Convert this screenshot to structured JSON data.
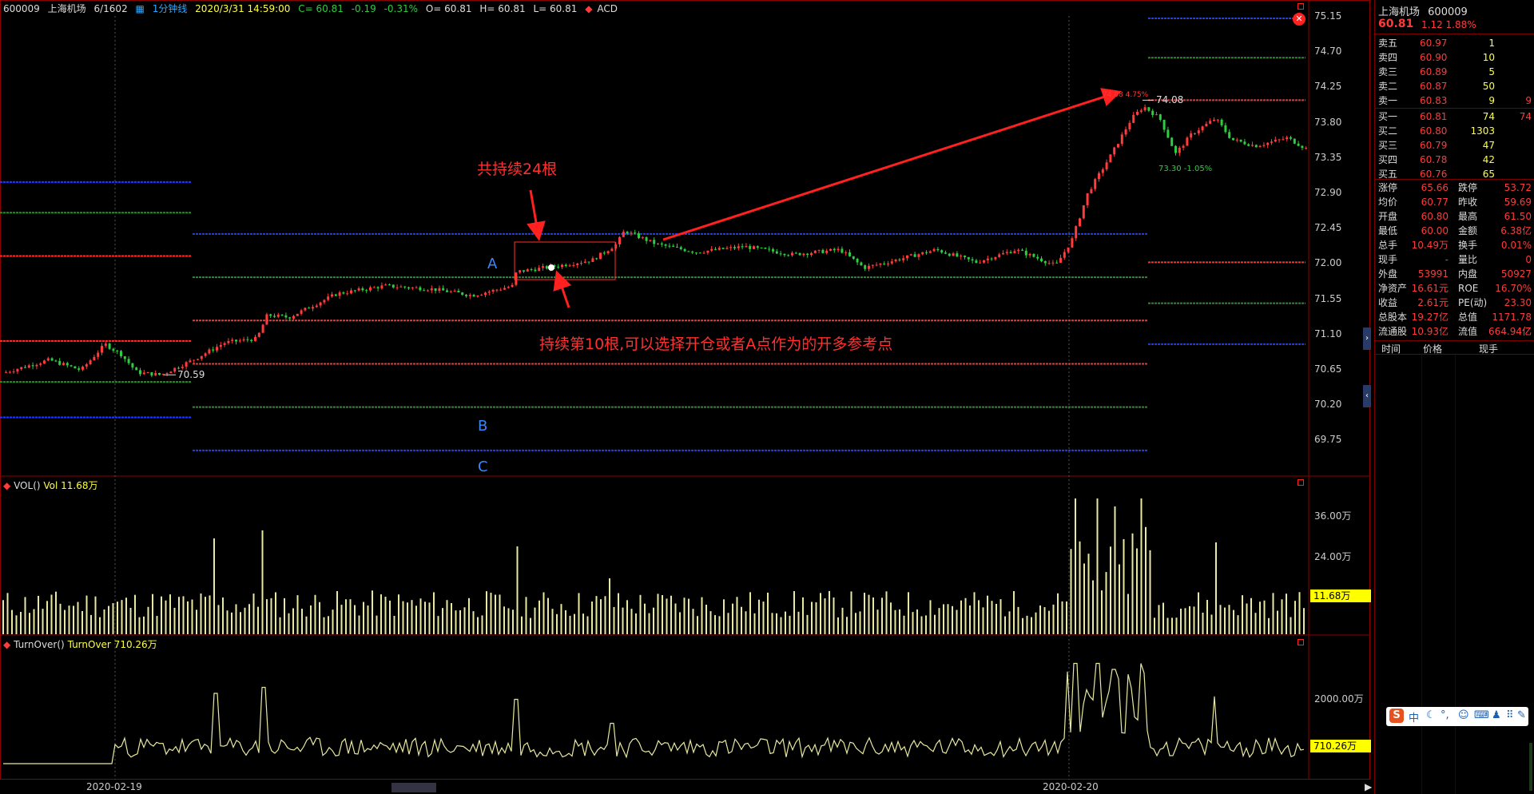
{
  "topbar": {
    "code": "600009",
    "name": "上海机场",
    "position": "6/1602",
    "period": "1分钟线",
    "datetime": "2020/3/31 14:59:00",
    "close": "C= 60.81",
    "change": "-0.19",
    "change_pct": "-0.31%",
    "open": "O= 60.81",
    "high": "H= 60.81",
    "low": "L= 60.81",
    "indicator": "ACD"
  },
  "price_axis": [
    "75.15",
    "74.70",
    "74.25",
    "73.80",
    "73.35",
    "72.90",
    "72.45",
    "72.00",
    "71.55",
    "71.10",
    "70.65",
    "70.20",
    "69.75"
  ],
  "vol_axis": [
    "36.00万",
    "24.00万"
  ],
  "vol_header": {
    "name": "VOL()",
    "value": "Vol 11.68万"
  },
  "vol_badge": "11.68万",
  "turnover_axis": [
    "2000.00万"
  ],
  "turnover_header": {
    "name": "TurnOver()",
    "value": "TurnOver 710.26万"
  },
  "turnover_badge": "710.26万",
  "dates": [
    "2020-02-19",
    "2020-02-20"
  ],
  "chart_labels": {
    "low_mark": "70.59",
    "high_mark": "74.08",
    "high_mark_small": "74.08 4.75%",
    "low2_mark": "73.30 -1.05%"
  },
  "annotations": {
    "top": "共持续24根",
    "bottom": "持续第10根,可以选择开仓或者A点作为的开多参考点",
    "label_a": "A",
    "label_b": "B",
    "label_c": "C"
  },
  "quote": {
    "name": "上海机场",
    "code": "600009",
    "price": "60.81",
    "change": "1.12 1.88%",
    "asks": [
      {
        "label": "卖五",
        "price": "60.97",
        "vol": "1",
        "extra": ""
      },
      {
        "label": "卖四",
        "price": "60.90",
        "vol": "10",
        "extra": ""
      },
      {
        "label": "卖三",
        "price": "60.89",
        "vol": "5",
        "extra": ""
      },
      {
        "label": "卖二",
        "price": "60.87",
        "vol": "50",
        "extra": ""
      },
      {
        "label": "卖一",
        "price": "60.83",
        "vol": "9",
        "extra": "9"
      }
    ],
    "bids": [
      {
        "label": "买一",
        "price": "60.81",
        "vol": "74",
        "extra": "74"
      },
      {
        "label": "买二",
        "price": "60.80",
        "vol": "1303",
        "extra": ""
      },
      {
        "label": "买三",
        "price": "60.79",
        "vol": "47",
        "extra": ""
      },
      {
        "label": "买四",
        "price": "60.78",
        "vol": "42",
        "extra": ""
      },
      {
        "label": "买五",
        "price": "60.76",
        "vol": "65",
        "extra": ""
      }
    ],
    "stats": [
      {
        "l1": "涨停",
        "v1": "65.66",
        "l2": "跌停",
        "v2": "53.72"
      },
      {
        "l1": "均价",
        "v1": "60.77",
        "l2": "昨收",
        "v2": "59.69"
      },
      {
        "l1": "开盘",
        "v1": "60.80",
        "l2": "最高",
        "v2": "61.50"
      },
      {
        "l1": "最低",
        "v1": "60.00",
        "l2": "金额",
        "v2": "6.38亿"
      },
      {
        "l1": "总手",
        "v1": "10.49万",
        "l2": "换手",
        "v2": "0.01%"
      },
      {
        "l1": "现手",
        "v1": "-",
        "l2": "量比",
        "v2": "0"
      },
      {
        "l1": "外盘",
        "v1": "53991",
        "l2": "内盘",
        "v2": "50927"
      },
      {
        "l1": "净资产",
        "v1": "16.61元",
        "l2": "ROE",
        "v2": "16.70%"
      },
      {
        "l1": "收益",
        "v1": "2.61元",
        "l2": "PE(动)",
        "v2": "23.30"
      },
      {
        "l1": "总股本",
        "v1": "19.27亿",
        "l2": "总值",
        "v2": "1171.78亿"
      },
      {
        "l1": "流通股",
        "v1": "10.93亿",
        "l2": "流值",
        "v2": "664.94亿"
      }
    ],
    "trade_headers": [
      "时间",
      "价格",
      "现手"
    ]
  },
  "colors": {
    "up": "#ff3b3b",
    "down": "#2ecc40",
    "vol": "#e8e8a0",
    "frame": "#8b0000",
    "blue_line": "#1f3cff",
    "red_line": "#ff3030",
    "green_line": "#2e8b2e"
  },
  "ime": {
    "logo": "S",
    "lang": "中"
  }
}
